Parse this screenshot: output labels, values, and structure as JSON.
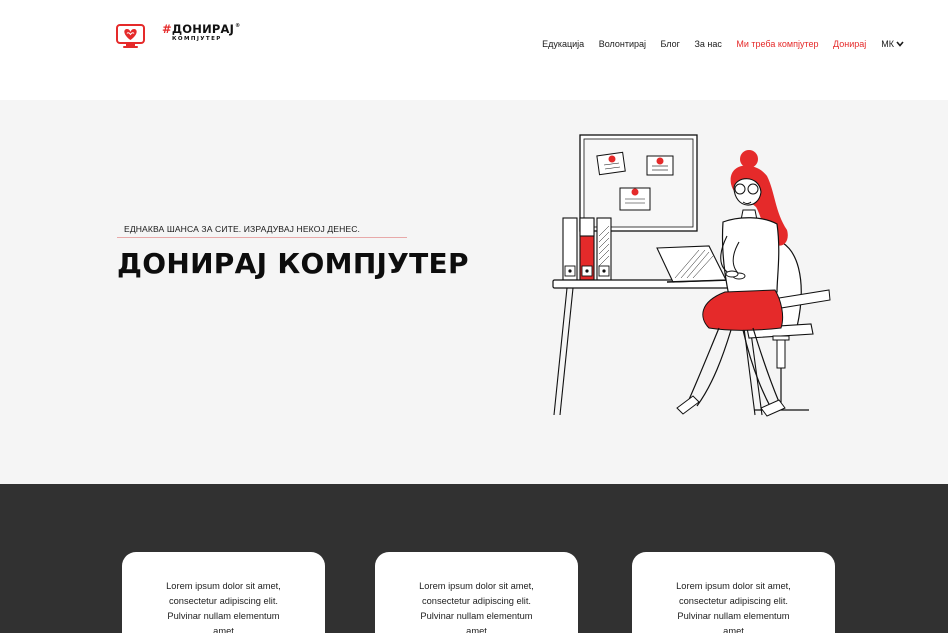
{
  "brand": {
    "hash": "#",
    "name": "ДОНИРАЈ",
    "registered": "®",
    "sub": "КОМПЈУТЕР"
  },
  "nav": {
    "items": [
      {
        "label": "Едукација",
        "highlight": false
      },
      {
        "label": "Волонтирај",
        "highlight": false
      },
      {
        "label": "Блог",
        "highlight": false
      },
      {
        "label": "За нас",
        "highlight": false
      },
      {
        "label": "Ми треба компјутер",
        "highlight": true
      },
      {
        "label": "Донирај",
        "highlight": true
      }
    ],
    "language": "МК",
    "language_icon": "chevron-down-icon"
  },
  "hero": {
    "tagline": "ЕДНАКВА ШАНСА ЗА СИТЕ. ИЗРАДУВАЈ НЕКОЈ ДЕНЕС.",
    "title": "ДОНИРАЈ КОМПЈУТЕР",
    "illustration_icon": "woman-at-desk-illustration"
  },
  "cards": [
    {
      "text": "Lorem ipsum dolor sit amet, consectetur adipiscing elit. Pulvinar nullam elementum amet"
    },
    {
      "text": "Lorem ipsum dolor sit amet, consectetur adipiscing elit. Pulvinar nullam elementum amet"
    },
    {
      "text": "Lorem ipsum dolor sit amet, consectetur adipiscing elit. Pulvinar nullam elementum amet"
    }
  ],
  "colors": {
    "accent": "#e52a2a",
    "hero_bg": "#f5f5f5",
    "dark_bg": "#313131"
  }
}
